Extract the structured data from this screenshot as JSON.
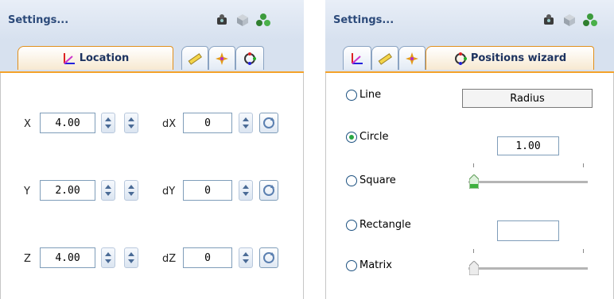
{
  "left_panel": {
    "title": "Settings...",
    "header_icons": [
      "camera-icon",
      "cube-icon",
      "molecule-icon"
    ],
    "tabs": [
      {
        "label": "Location",
        "icon": "axes-icon",
        "active": true
      },
      {
        "label": "",
        "icon": "ruler-icon",
        "active": false
      },
      {
        "label": "",
        "icon": "sparkle-icon",
        "active": false
      },
      {
        "label": "",
        "icon": "cycle-icon",
        "active": false
      }
    ],
    "rows": [
      {
        "label": "X",
        "value": "4.00",
        "delta_label": "dX",
        "delta_value": "0"
      },
      {
        "label": "Y",
        "value": "2.00",
        "delta_label": "dY",
        "delta_value": "0"
      },
      {
        "label": "Z",
        "value": "4.00",
        "delta_label": "dZ",
        "delta_value": "0"
      }
    ]
  },
  "right_panel": {
    "title": "Settings...",
    "header_icons": [
      "camera-icon",
      "cube-icon",
      "molecule-icon"
    ],
    "tabs": [
      {
        "label": "",
        "icon": "axes-icon",
        "active": false
      },
      {
        "label": "",
        "icon": "ruler-icon",
        "active": false
      },
      {
        "label": "",
        "icon": "sparkle-icon",
        "active": false
      },
      {
        "label": "Positions wizard",
        "icon": "cycle-icon",
        "active": true
      }
    ],
    "shapes": [
      {
        "label": "Line",
        "selected": false
      },
      {
        "label": "Circle",
        "selected": true
      },
      {
        "label": "Square",
        "selected": false
      },
      {
        "label": "Rectangle",
        "selected": false
      },
      {
        "label": "Matrix",
        "selected": false
      }
    ],
    "param_label": "Radius",
    "radius_value": "1.00",
    "empty_field_value": ""
  }
}
